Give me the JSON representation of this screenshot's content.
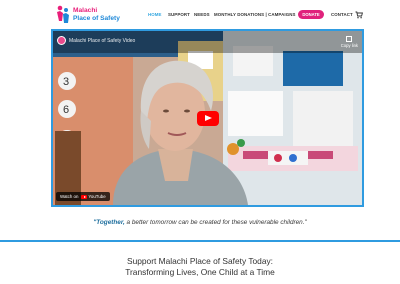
{
  "header": {
    "logo_line1": "Malachi",
    "logo_line2": "Place of Safety",
    "nav": [
      {
        "label": "HOME",
        "active": true
      },
      {
        "label": "SUPPORT",
        "active": false
      },
      {
        "label": "NEEDS",
        "active": false
      },
      {
        "label": "MONTHLY DONATIONS | CAMPAIGNS",
        "active": false
      },
      {
        "label": "DONATE",
        "active": false
      },
      {
        "label": "CONTACT",
        "active": false
      }
    ],
    "cart_icon": "cart-icon",
    "colors": {
      "accent": "#35a7e0",
      "donate": "#e0227c",
      "logo_pink": "#e91e7a",
      "logo_blue": "#1e88d8"
    }
  },
  "video": {
    "title": "Malachi Place of Safety Video",
    "copy_label": "Copy link",
    "watch_on_label": "Watch on",
    "youtube_label": "YouTube",
    "border_color": "#2f9be0"
  },
  "quote": {
    "emphasis": "\"Together,",
    "rest": " a better tomorrow can be created for these vulnerable children.\""
  },
  "headline": {
    "line1": "Support Malachi Place of Safety Today:",
    "line2": "Transforming Lives, One Child at a Time"
  }
}
